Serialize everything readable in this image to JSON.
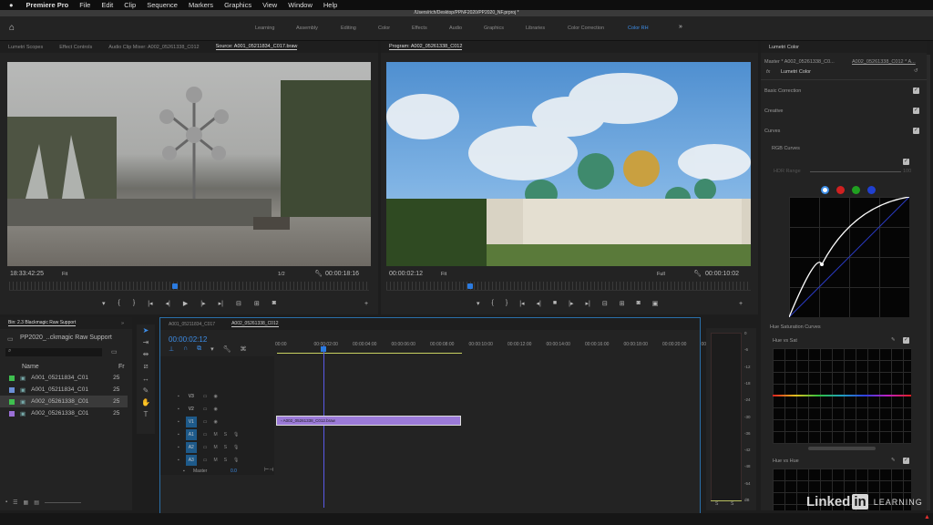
{
  "menubar": {
    "app": "Premiere Pro",
    "items": [
      "File",
      "Edit",
      "Clip",
      "Sequence",
      "Markers",
      "Graphics",
      "View",
      "Window",
      "Help"
    ]
  },
  "window_title": "/Users/rich/Desktop/PPNF2020/PP2020_NF.prproj *",
  "workspaces": [
    "Learning",
    "Assembly",
    "Editing",
    "Color",
    "Effects",
    "Audio",
    "Graphics",
    "Libraries",
    "Color Correction",
    "Color RH"
  ],
  "workspace_active": "Color RH",
  "workspace_more": "»",
  "left_tabs": [
    "Lumetri Scopes",
    "Effect Controls",
    "Audio Clip Mixer: A002_05261338_C012",
    "Source: A001_05211834_C017.braw"
  ],
  "program_tab": "Program: A002_05261338_C012",
  "source": {
    "timecode": "18:33:42:25",
    "zoom": "Fit",
    "resolution": "1/2",
    "duration": "00:00:18:16",
    "playhead": 0.46
  },
  "program": {
    "timecode": "00:00:02:12",
    "zoom": "Fit",
    "resolution": "Full",
    "duration": "00:00:10:02",
    "playhead": 0.23
  },
  "bin": {
    "tab": "Bin: 2.3 Blackmagic Raw Support",
    "title": "PP2020_..ckmagic Raw Support",
    "search_placeholder": "",
    "col_name": "Name",
    "col_fr": "Fr",
    "items": [
      {
        "name": "A001_05211834_C01",
        "fr": "25",
        "color": "#3fbf4f"
      },
      {
        "name": "A001_05211834_C01",
        "fr": "25",
        "color": "#6b8fd6"
      },
      {
        "name": "A002_05261338_C01",
        "fr": "25",
        "color": "#3fbf4f"
      },
      {
        "name": "A002_05261338_C01",
        "fr": "25",
        "color": "#9a6fd6"
      }
    ]
  },
  "timeline": {
    "tabs": [
      "A001_05211834_C017",
      "A002_05261338_C012"
    ],
    "active": "A002_05261338_C012",
    "timecode": "00:00:02:12",
    "ruler": [
      "00:00",
      "00:00:02:00",
      "00:00:04:00",
      "00:00:06:00",
      "00:00:08:00",
      "00:00:10:00",
      "00:00:12:00",
      "00:00:14:00",
      "00:00:16:00",
      "00:00:18:00",
      "00:00:20:00",
      "00:00:22"
    ],
    "video_tracks": [
      "V3",
      "V2",
      "V1"
    ],
    "audio_tracks": [
      "A1",
      "A2",
      "A3"
    ],
    "mute": "M",
    "solo": "S",
    "master": "Master",
    "master_value": "0.0",
    "clip": "A002_05261338_C012.braw"
  },
  "meter": {
    "scale": [
      "0",
      "-6",
      "-12",
      "-18",
      "-24",
      "-30",
      "-36",
      "-42",
      "-48",
      "-54",
      "dB"
    ],
    "solo": [
      "S",
      "S"
    ]
  },
  "lumetri": {
    "title": "Lumetri Color",
    "master": "Master * A002_05261338_C0...",
    "clip": "A002_05261338_C012 * A...",
    "effect": "Lumetri Color",
    "sections": [
      "Basic Correction",
      "Creative",
      "Curves"
    ],
    "rgb_curves": "RGB Curves",
    "hdr_label": "HDR Range",
    "hdr_value": "100",
    "hue_sat": "Hue Saturation Curves",
    "hue_vs_sat": "Hue vs Sat",
    "hue_vs_hue": "Hue vs Hue",
    "channels": [
      "#ffffff",
      "#d02020",
      "#20a020",
      "#2040d0"
    ]
  },
  "watermark": "Linked in LEARNING"
}
